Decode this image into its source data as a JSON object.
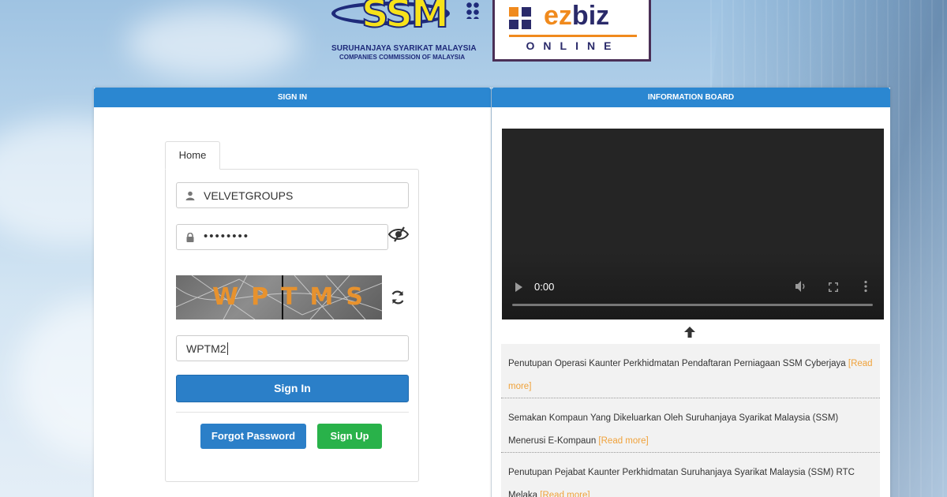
{
  "logos": {
    "ssm_text": "SSM",
    "ssm_line1": "SURUHANJAYA SYARIKAT MALAYSIA",
    "ssm_line2": "COMPANIES COMMISSION OF MALAYSIA",
    "ez": "ez",
    "biz": "biz",
    "online": "ONLINE"
  },
  "signin": {
    "header": "SIGN IN",
    "tab": "Home",
    "username_value": "VELVETGROUPS",
    "password_value": "••••••••",
    "captcha_image_text": "WPTMS",
    "captcha_input_value": "WPTM2",
    "signin_label": "Sign In",
    "forgot_label": "Forgot Password",
    "signup_label": "Sign Up"
  },
  "info": {
    "header": "INFORMATION BOARD",
    "video_time": "0:00",
    "news": [
      {
        "text": "Penutupan Operasi Kaunter Perkhidmatan Pendaftaran Perniagaan SSM Cyberjaya ",
        "link": "[Read more]"
      },
      {
        "text": "Semakan Kompaun Yang Dikeluarkan Oleh Suruhanjaya Syarikat Malaysia (SSM) Menerusi E-Kompaun ",
        "link": "[Read more]"
      },
      {
        "text": "Penutupan Pejabat Kaunter Perkhidmatan Suruhanjaya Syarikat Malaysia (SSM) RTC Melaka ",
        "link": "[Read more]"
      }
    ]
  },
  "colors": {
    "header_blue": "#2b87d1",
    "signin_blue": "#2b7fc8",
    "signup_green": "#29b24a",
    "read_more": "#f0a23a"
  }
}
